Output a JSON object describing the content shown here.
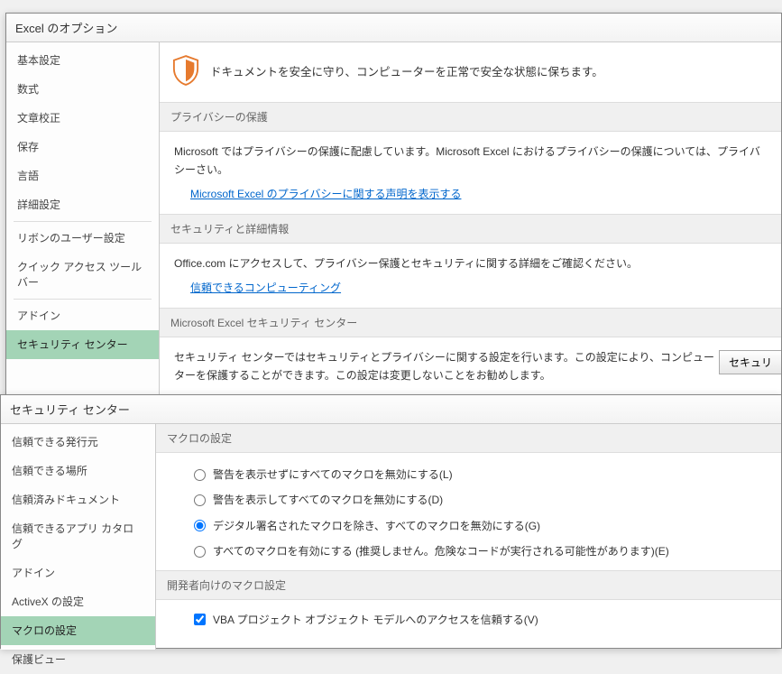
{
  "win1": {
    "title": "Excel のオプション",
    "sidebar": [
      "基本設定",
      "数式",
      "文章校正",
      "保存",
      "言語",
      "詳細設定",
      "リボンのユーザー設定",
      "クイック アクセス ツール バー",
      "アドイン",
      "セキュリティ センター"
    ],
    "selectedIndex": 9,
    "banner": "ドキュメントを安全に守り、コンピューターを正常で安全な状態に保ちます。",
    "sec_privacy": {
      "header": "プライバシーの保護",
      "body": "Microsoft ではプライバシーの保護に配慮しています。Microsoft Excel におけるプライバシーの保護については、プライバシーさい。",
      "link": "Microsoft Excel のプライバシーに関する声明を表示する"
    },
    "sec_info": {
      "header": "セキュリティと詳細情報",
      "body": "Office.com にアクセスして、プライバシー保護とセキュリティに関する詳細をご確認ください。",
      "link": "信頼できるコンピューティング"
    },
    "sec_center": {
      "header": "Microsoft Excel セキュリティ センター",
      "body": "セキュリティ センターではセキュリティとプライバシーに関する設定を行います。この設定により、コンピューターを保護することができます。この設定は変更しないことをお勧めします。",
      "button": "セキュリ"
    }
  },
  "win2": {
    "title": "セキュリティ センター",
    "sidebar": [
      "信頼できる発行元",
      "信頼できる場所",
      "信頼済みドキュメント",
      "信頼できるアプリ カタログ",
      "アドイン",
      "ActiveX の設定",
      "マクロの設定",
      "保護ビュー"
    ],
    "selectedIndex": 6,
    "macro": {
      "header": "マクロの設定",
      "options": [
        "警告を表示せずにすべてのマクロを無効にする(L)",
        "警告を表示してすべてのマクロを無効にする(D)",
        "デジタル署名されたマクロを除き、すべてのマクロを無効にする(G)",
        "すべてのマクロを有効にする (推奨しません。危険なコードが実行される可能性があります)(E)"
      ],
      "selected": 2
    },
    "dev": {
      "header": "開発者向けのマクロ設定",
      "checkbox": "VBA プロジェクト オブジェクト モデルへのアクセスを信頼する(V)",
      "checked": true
    }
  }
}
